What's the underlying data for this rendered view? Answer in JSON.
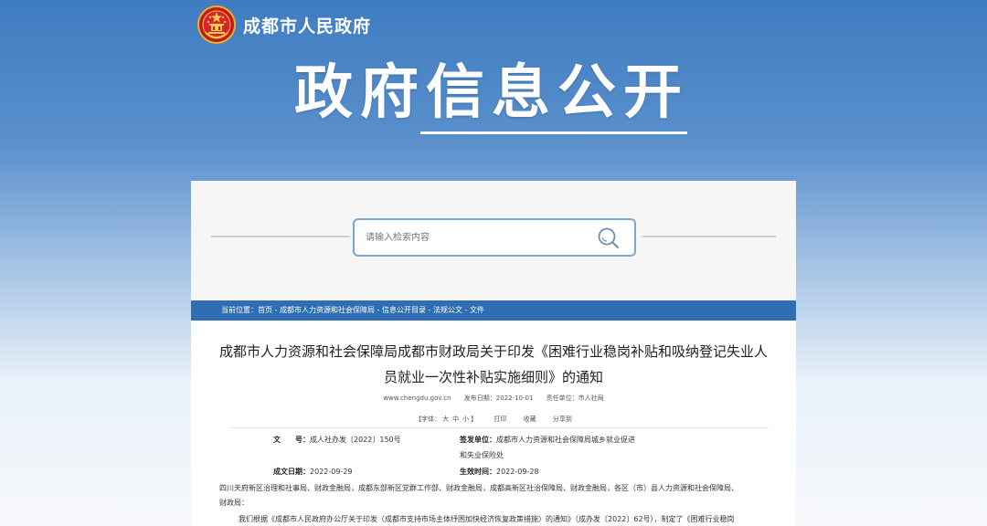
{
  "header": {
    "site_name": "成都市人民政府",
    "banner_title": "政府信息公开"
  },
  "search": {
    "placeholder": "请输入检索内容",
    "icon": "search-icon"
  },
  "breadcrumb": {
    "prefix": "当前位置：",
    "items": [
      "首页",
      "成都市人力资源和社会保障局",
      "信息公开目录",
      "法规公文",
      "文件"
    ],
    "separator": " - "
  },
  "article": {
    "title_line1": "成都市人力资源和社会保障局成都市财政局关于印发《困难行业稳岗补贴和吸纳登记失业人",
    "title_line2": "员就业一次性补贴实施细则》的通知",
    "source_site": "www.chengdu.gov.cn",
    "publish_date_label": "发布日期：",
    "publish_date": "2022-10-01",
    "editor_label": "责任单位：",
    "editor": "市人社局",
    "font_size_label": "【字体：",
    "font_large": "大",
    "font_medium": "中",
    "font_small": "小",
    "font_size_end": "】",
    "print": "打印",
    "favorite": "收藏",
    "share": "分享到"
  },
  "info": {
    "doc_no_label": "文　　号：",
    "doc_no": "成人社办发〔2022〕150号",
    "issuer_label": "签发单位：",
    "issuer_line1": "成都市人力资源和社会保障局城乡就业促进",
    "issuer_line2": "和失业保险处",
    "date_label": "成文日期：",
    "date": "2022-09-29",
    "effective_label": "生效时间：",
    "effective": "2022-09-28"
  },
  "body": {
    "recipients_line1": "四川天府新区治理和社事局、财政金融局，成都东部新区党群工作部、财政金融局，成都高新区社治保障局、财政金融局，各区（市）县人力资源和社会保障局、",
    "recipients_line2": "财政局：",
    "para1": "我们根据《成都市人民政府办公厅关于印发〈成都市支持市场主体纾困加快经济恢复政策措施〉的通知》（成办发〔2022〕62号），制定了《困难行业稳岗"
  }
}
